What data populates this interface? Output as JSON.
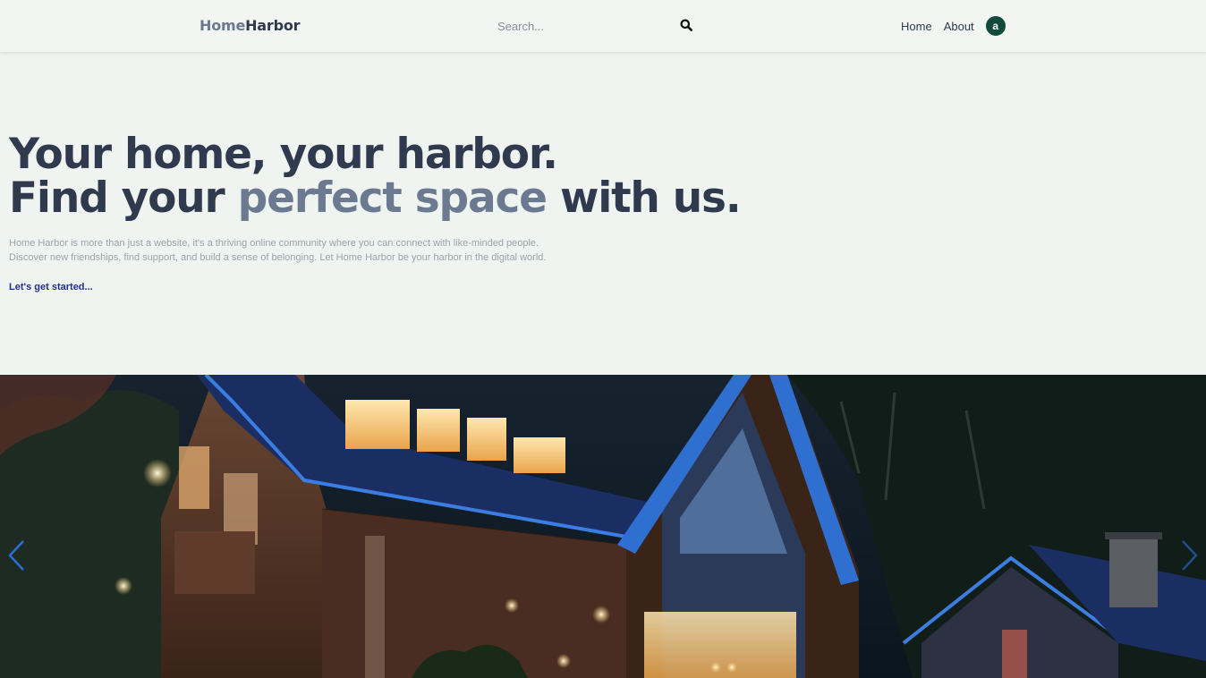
{
  "header": {
    "logo_part1": "Home",
    "logo_part2": "Harbor",
    "search": {
      "placeholder": "Search...",
      "icon": "search-icon"
    },
    "nav": [
      {
        "label": "Home"
      },
      {
        "label": "About"
      }
    ],
    "avatar_initial": "a"
  },
  "hero": {
    "title_line1": "Your home, your harbor.",
    "title_line2_pre": "Find your ",
    "title_line2_accent": "perfect space",
    "title_line2_post": " with us.",
    "description_line1": "Home Harbor is more than just a website, it's a thriving online community where you can connect with like-minded people.",
    "description_line2": "Discover new friendships, find support, and build a sense of belonging. Let Home Harbor be your harbor in the digital world.",
    "cta": "Let's get started..."
  },
  "carousel": {
    "prev_icon": "chevron-left-icon",
    "next_icon": "chevron-right-icon",
    "image": "house-at-dusk-photo"
  },
  "colors": {
    "background": "#f0f4f1",
    "text_dark": "#2f3a4f",
    "accent_slate": "#6b7a90",
    "cta_blue": "#1f2f8f",
    "avatar_green": "#0f4a3a",
    "arrow_blue": "#2a6fd6"
  }
}
